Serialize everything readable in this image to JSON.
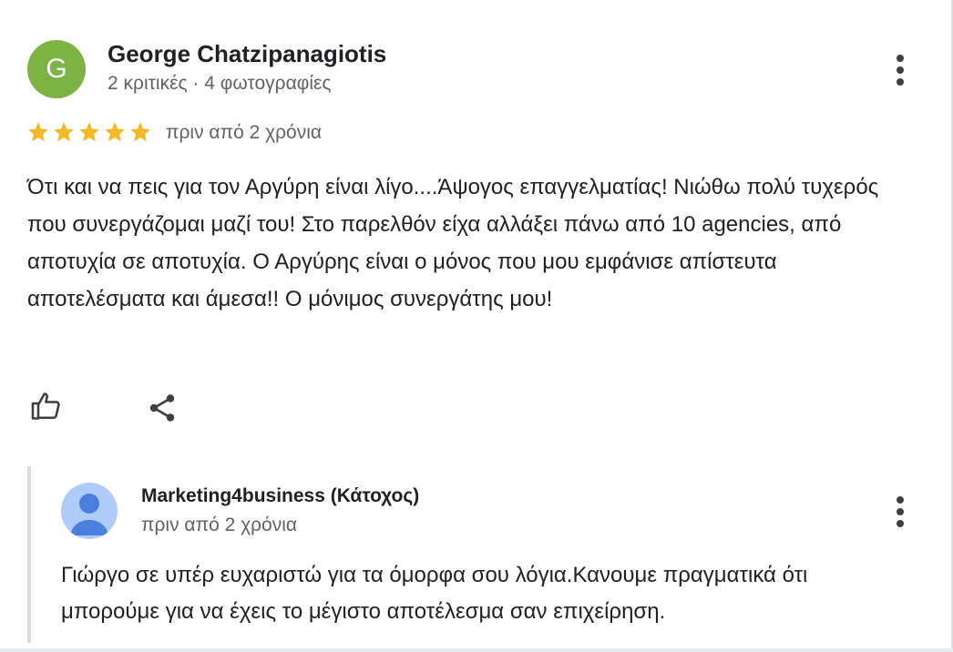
{
  "review": {
    "avatar_letter": "G",
    "avatar_color": "#7cb342",
    "author": "George Chatzipanagiotis",
    "meta": "2 κριτικές · 4 φωτογραφίες",
    "rating": 5,
    "rating_max": 5,
    "time": "πριν από 2 χρόνια",
    "text": "Ότι και να πεις για τον Αργύρη είναι λίγο....Άψογος επαγγελματίας! Νιώθω πολύ τυχερός που συνεργάζομαι μαζί του! Στο παρελθόν είχα αλλάξει πάνω από 10 agencies, από αποτυχία σε αποτυχία. Ο Αργύρης είναι ο μόνος που μου εμφάνισε απίστευτα αποτελέσματα και άμεσα!! Ο μόνιμος συνεργάτης μου!",
    "actions": {
      "like_icon": "thumb-up-icon",
      "share_icon": "share-icon",
      "menu_icon": "more-vert-icon"
    }
  },
  "reply": {
    "author": "Marketing4business (Κάτοχος)",
    "time": "πριν από 2 χρόνια",
    "text": "Γιώργο σε υπέρ ευχαριστώ για τα όμορφα σου λόγια.Κανουμε πραγματικά ότι μπορούμε για να έχεις το μέγιστο αποτέλεσμα σαν επιχείρηση.",
    "avatar_icon": "person-icon",
    "menu_icon": "more-vert-icon"
  },
  "colors": {
    "star": "#f6b825",
    "owner_avatar_bg": "#aecbfa",
    "owner_avatar_fg": "#4a7fe0"
  }
}
